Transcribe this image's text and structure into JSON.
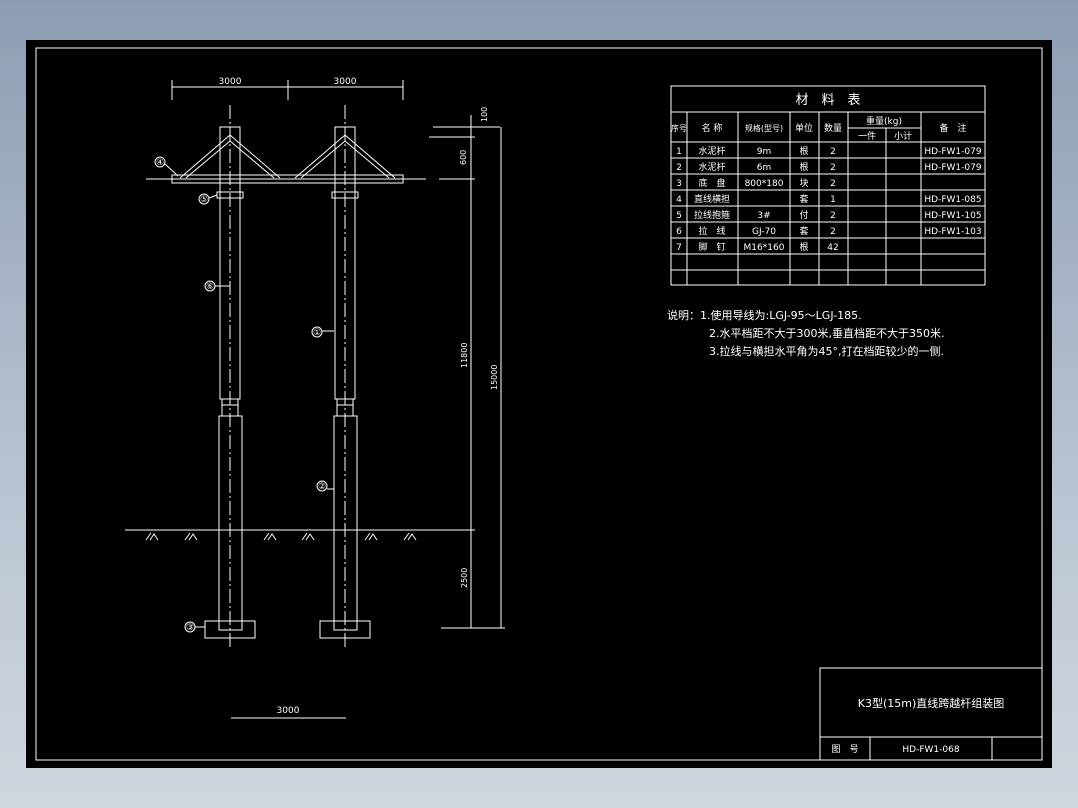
{
  "drawing": {
    "dims": {
      "top_left": "3000",
      "top_right": "3000",
      "bottom": "3000",
      "d100": "100",
      "d600": "600",
      "d11800": "11800",
      "d15000": "15000",
      "d2500": "2500"
    },
    "callouts": [
      "①",
      "②",
      "③",
      "④",
      "⑤",
      "⑥"
    ]
  },
  "material_table": {
    "title": "材　料　表",
    "headers": {
      "no": "序号",
      "name": "名 称",
      "spec": "规格(型号)",
      "unit": "单位",
      "qty": "数量",
      "weight": "重量(kg)",
      "each": "一件",
      "subtotal": "小计",
      "remark": "备　注"
    },
    "rows": [
      {
        "no": "1",
        "name": "水泥杆",
        "spec": "9m",
        "unit": "根",
        "qty": "2",
        "remark": "HD-FW1-079"
      },
      {
        "no": "2",
        "name": "水泥杆",
        "spec": "6m",
        "unit": "根",
        "qty": "2",
        "remark": "HD-FW1-079"
      },
      {
        "no": "3",
        "name": "底　盘",
        "spec": "800*180",
        "unit": "块",
        "qty": "2",
        "remark": ""
      },
      {
        "no": "4",
        "name": "直线横担",
        "spec": "",
        "unit": "套",
        "qty": "1",
        "remark": "HD-FW1-085"
      },
      {
        "no": "5",
        "name": "拉线抱箍",
        "spec": "3#",
        "unit": "付",
        "qty": "2",
        "remark": "HD-FW1-105"
      },
      {
        "no": "6",
        "name": "拉　线",
        "spec": "GJ-70",
        "unit": "套",
        "qty": "2",
        "remark": "HD-FW1-103"
      },
      {
        "no": "7",
        "name": "脚　钉",
        "spec": "M16*160",
        "unit": "根",
        "qty": "42",
        "remark": ""
      }
    ]
  },
  "notes": {
    "line1": "说明：1.使用导线为:LGJ-95～LGJ-185.",
    "line2": "2.水平档距不大于300米,垂直档距不大于350米.",
    "line3": "3.拉线与横担水平角为45°,打在档距较少的一侧."
  },
  "title_block": {
    "title": "K3型(15m)直线跨越杆组装图",
    "drawing_no_label": "图　号",
    "drawing_no": "HD-FW1-068"
  }
}
